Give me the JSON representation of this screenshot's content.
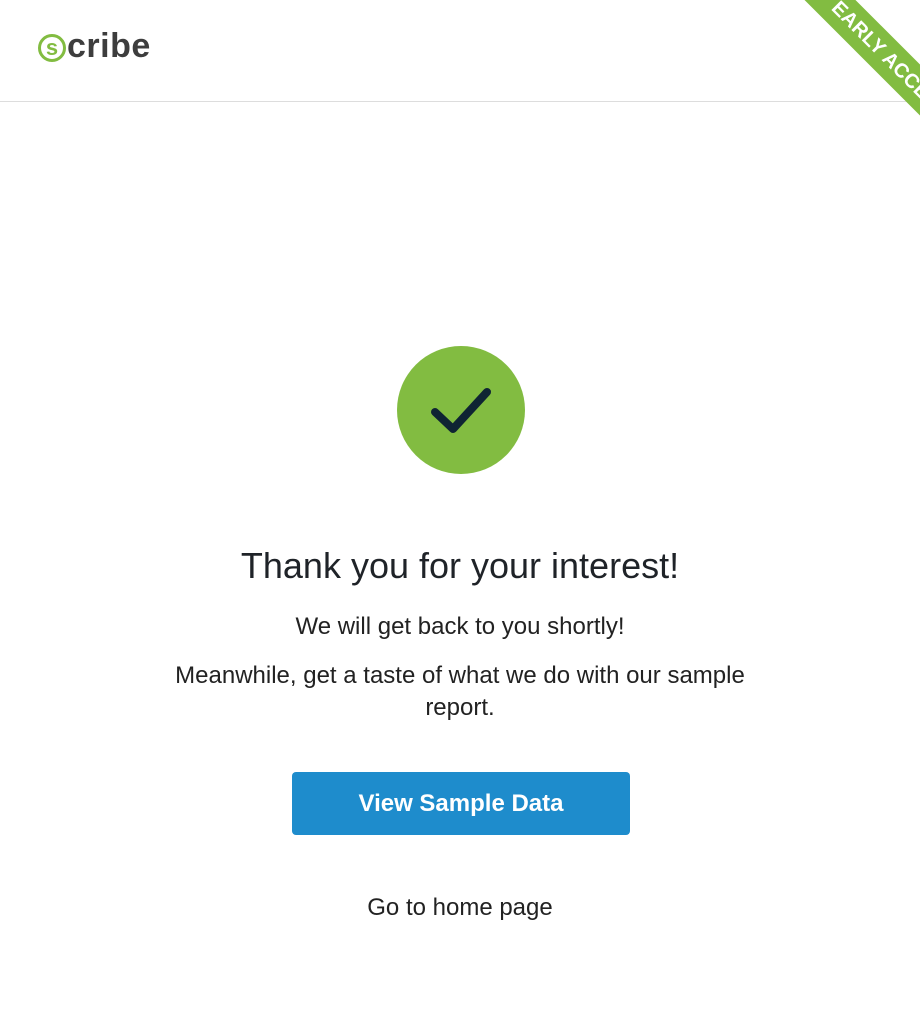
{
  "header": {
    "logo": {
      "initial": "s",
      "rest": "cribe"
    },
    "ribbon_label": "EARLY ACCESS"
  },
  "main": {
    "heading": "Thank you for your interest!",
    "message_line1": "We will get back to you shortly!",
    "message_line2": "Meanwhile, get a taste of what we do with our sample report.",
    "cta_label": "View Sample Data",
    "home_link_label": "Go to home page"
  },
  "icons": {
    "success": "checkmark-icon"
  },
  "colors": {
    "brand_green": "#82bc41",
    "button_blue": "#1e8ccc",
    "check_mark": "#0f2433",
    "logo_text": "#3d3d3d"
  }
}
